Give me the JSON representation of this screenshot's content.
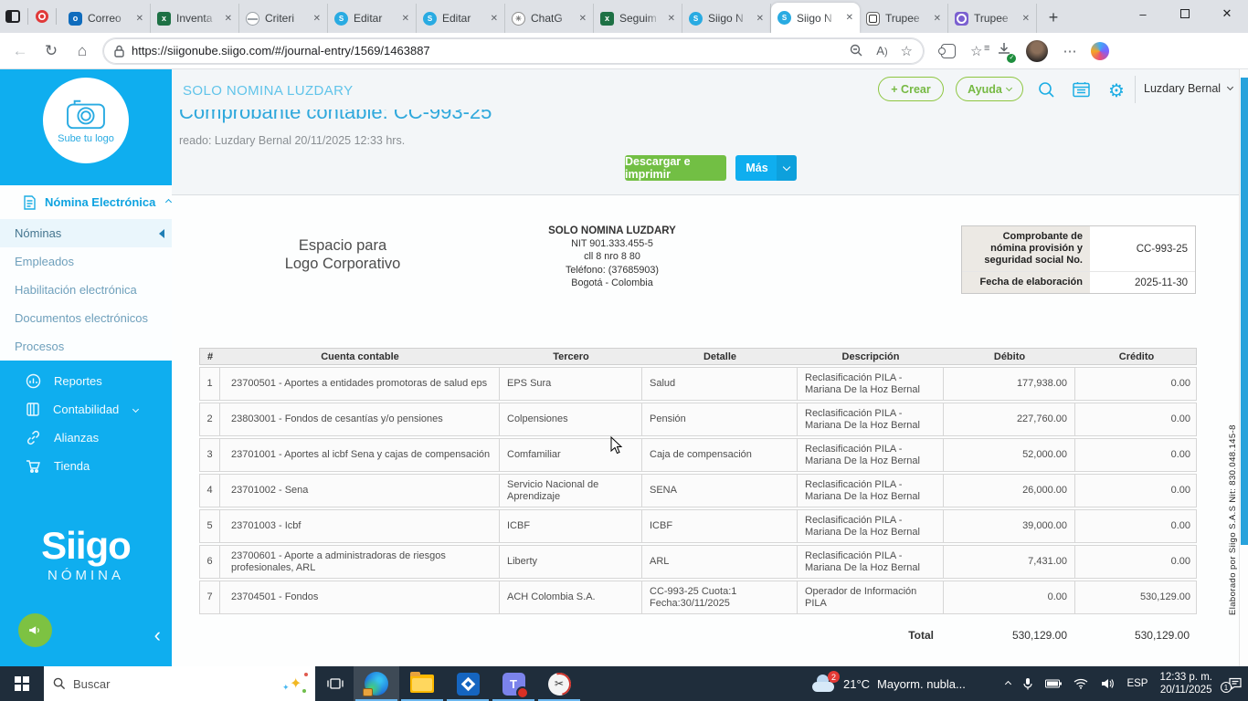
{
  "colors": {
    "siigo_blue": "#0FAEEF",
    "accent_green": "#72BF44",
    "title_blue": "#29ABE2"
  },
  "browser": {
    "tabs": [
      {
        "label": "Correo",
        "icon": "outlook"
      },
      {
        "label": "Inventa",
        "icon": "excel"
      },
      {
        "label": "Criteri",
        "icon": "globe"
      },
      {
        "label": "Editar",
        "icon": "siigo"
      },
      {
        "label": "Editar",
        "icon": "siigo"
      },
      {
        "label": "ChatG",
        "icon": "chatgpt"
      },
      {
        "label": "Seguim",
        "icon": "excel"
      },
      {
        "label": "Siigo N",
        "icon": "siigo"
      },
      {
        "label": "Siigo N",
        "icon": "siigo",
        "active": true
      },
      {
        "label": "Trupee",
        "icon": "trupee-light"
      },
      {
        "label": "Trupee",
        "icon": "trupee-purple"
      }
    ],
    "url": "https://siigonube.siigo.com/#/journal-entry/1569/1463887"
  },
  "sidebar": {
    "upload_logo_label": "Sube tu logo",
    "module_label": "Nómina Electrónica",
    "items": [
      {
        "label": "Nóminas",
        "active": true
      },
      {
        "label": "Empleados"
      },
      {
        "label": "Habilitación electrónica"
      },
      {
        "label": "Documentos electrónicos"
      },
      {
        "label": "Procesos"
      }
    ],
    "sections": [
      {
        "label": "Reportes"
      },
      {
        "label": "Contabilidad"
      },
      {
        "label": "Alianzas"
      },
      {
        "label": "Tienda"
      }
    ],
    "brand_name": "Siigo",
    "brand_product": "NÓMINA"
  },
  "header": {
    "company_name": "SOLO NOMINA LUZDARY",
    "create_label": "+ Crear",
    "help_label": "Ayuda",
    "user_name": "Luzdary Bernal"
  },
  "page": {
    "title": "Comprobante contable: CC-993-25",
    "created": "reado: Luzdary Bernal 20/11/2025 12:33 hrs.",
    "download_label": "Descargar e imprimir",
    "more_label": "Más"
  },
  "document": {
    "logo_placeholder": "Espacio para\nLogo Corporativo",
    "company": {
      "name": "SOLO NOMINA LUZDARY",
      "nit": "NIT 901.333.455-5",
      "address": "cll 8 nro 8 80",
      "phone": "Teléfono: (37685903)",
      "city": "Bogotá - Colombia"
    },
    "voucher": {
      "number_label": "Comprobante de nómina provisión y seguridad social No.",
      "number": "CC-993-25",
      "date_label": "Fecha de elaboración",
      "date": "2025-11-30"
    },
    "table": {
      "headers": [
        "#",
        "Cuenta contable",
        "Tercero",
        "Detalle",
        "Descripción",
        "Débito",
        "Crédito"
      ],
      "rows": [
        {
          "n": "1",
          "cuenta": "23700501 - Aportes a entidades promotoras de salud eps",
          "tercero": "EPS Sura",
          "detalle": "Salud",
          "descripcion": "Reclasificación PILA - Mariana De la Hoz Bernal",
          "debito": "177,938.00",
          "credito": "0.00"
        },
        {
          "n": "2",
          "cuenta": "23803001 - Fondos de cesantías y/o pensiones",
          "tercero": "Colpensiones",
          "detalle": "Pensión",
          "descripcion": "Reclasificación PILA - Mariana De la Hoz Bernal",
          "debito": "227,760.00",
          "credito": "0.00"
        },
        {
          "n": "3",
          "cuenta": "23701001 - Aportes al icbf Sena y cajas de compensación",
          "tercero": "Comfamiliar",
          "detalle": "Caja de compensación",
          "descripcion": "Reclasificación PILA - Mariana De la Hoz Bernal",
          "debito": "52,000.00",
          "credito": "0.00"
        },
        {
          "n": "4",
          "cuenta": "23701002 - Sena",
          "tercero": "Servicio Nacional de Aprendizaje",
          "detalle": "SENA",
          "descripcion": "Reclasificación PILA - Mariana De la Hoz Bernal",
          "debito": "26,000.00",
          "credito": "0.00"
        },
        {
          "n": "5",
          "cuenta": "23701003 - Icbf",
          "tercero": "ICBF",
          "detalle": "ICBF",
          "descripcion": "Reclasificación PILA - Mariana De la Hoz Bernal",
          "debito": "39,000.00",
          "credito": "0.00"
        },
        {
          "n": "6",
          "cuenta": "23700601 - Aporte a administradoras de riesgos profesionales, ARL",
          "tercero": "Liberty",
          "detalle": "ARL",
          "descripcion": "Reclasificación PILA - Mariana De la Hoz Bernal",
          "debito": "7,431.00",
          "credito": "0.00"
        },
        {
          "n": "7",
          "cuenta": "23704501 - Fondos",
          "tercero": "ACH Colombia S.A.",
          "detalle": "CC-993-25 Cuota:1\nFecha:30/11/2025",
          "descripcion": "Operador de Información PILA",
          "debito": "0.00",
          "credito": "530,129.00"
        }
      ],
      "total_label": "Total",
      "total_debito": "530,129.00",
      "total_credito": "530,129.00"
    },
    "watermark": "Elaborado por Siigo S.A.S Nit: 830.048.145-8"
  },
  "taskbar": {
    "search_placeholder": "Buscar",
    "weather_temp": "21°C",
    "weather_condition": "Mayorm. nubla...",
    "weather_badge": "2",
    "language": "ESP",
    "time": "12:33 p. m.",
    "date": "20/11/2025",
    "notification_badge": "1"
  }
}
